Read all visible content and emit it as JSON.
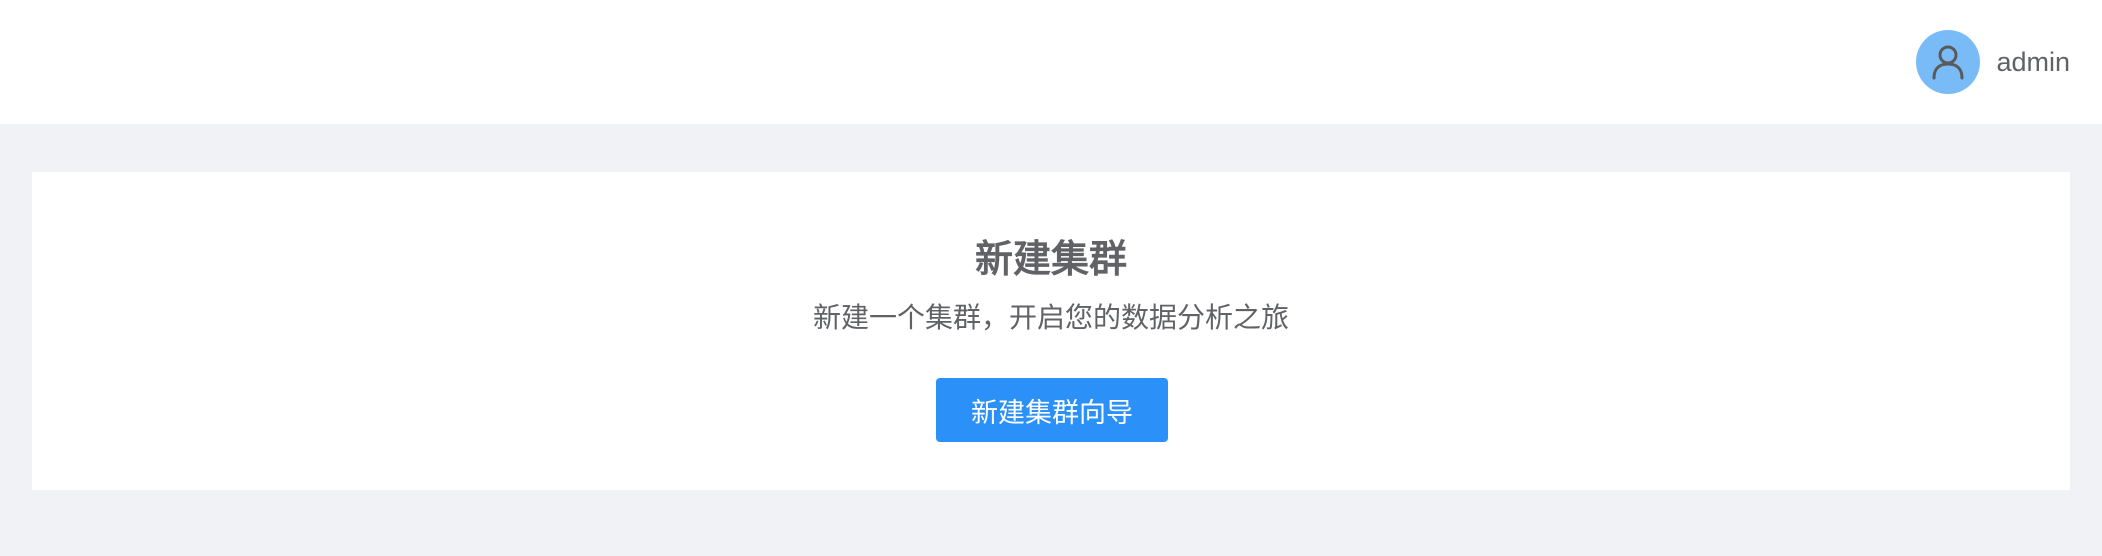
{
  "header": {
    "user": {
      "avatar_icon": "user-icon",
      "name": "admin"
    }
  },
  "main": {
    "title": "新建集群",
    "subtitle": "新建一个集群，开启您的数据分析之旅",
    "wizard_button_label": "新建集群向导"
  },
  "colors": {
    "primary": "#2b90f7",
    "avatar_bg": "#79bbf7",
    "page_bg": "#f0f2f5",
    "text": "#606266"
  }
}
